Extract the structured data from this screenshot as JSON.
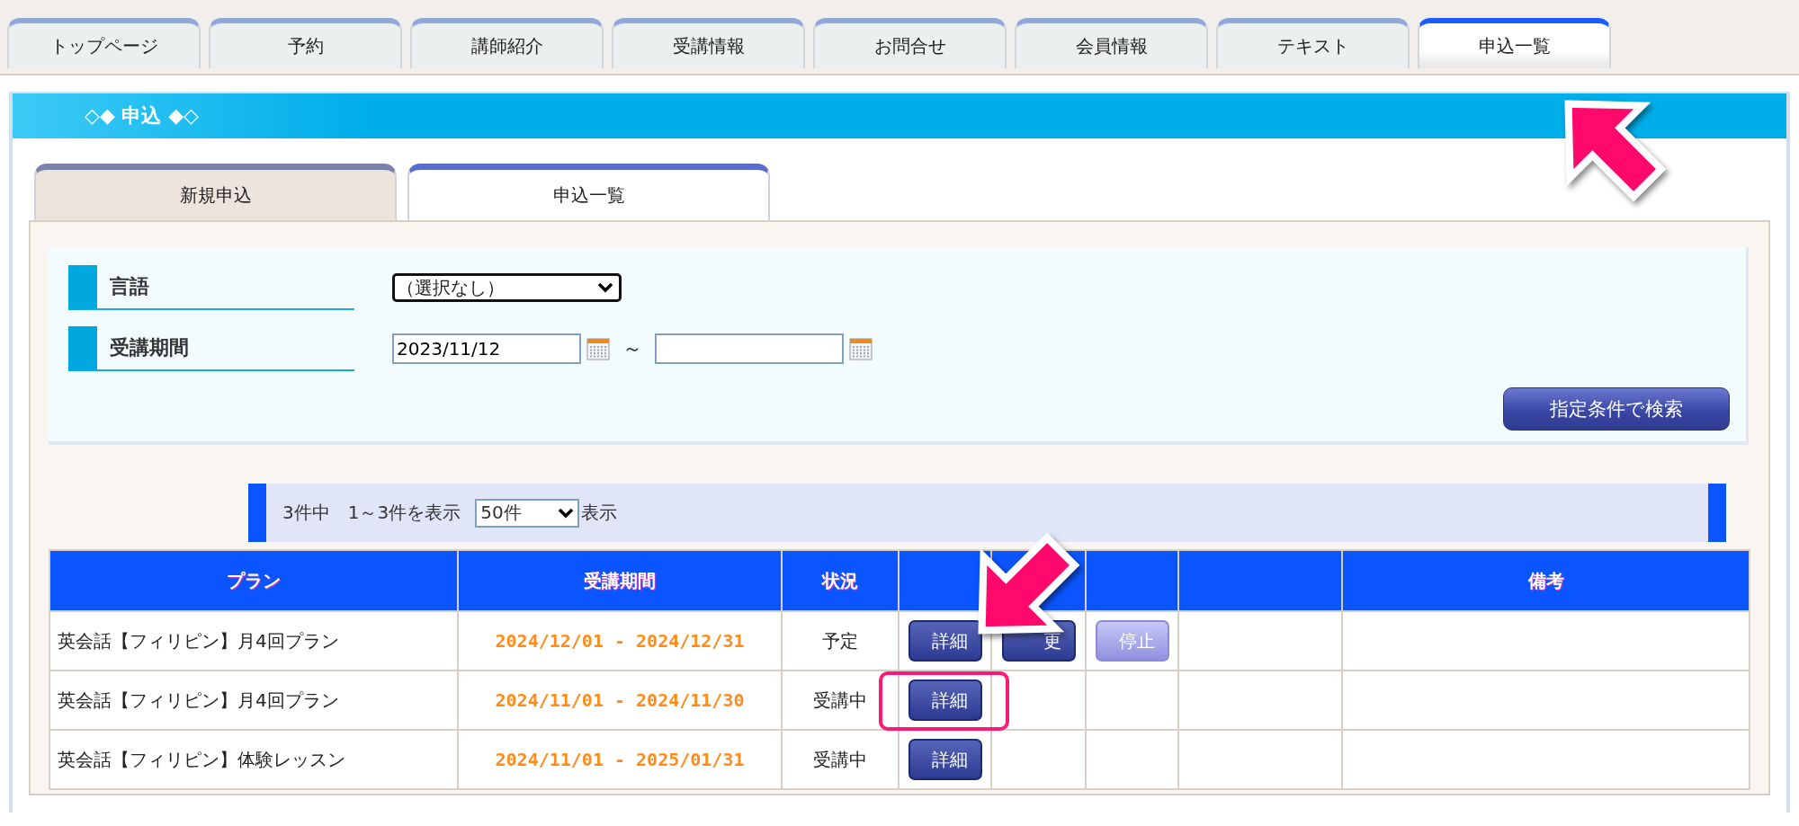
{
  "nav_tabs": [
    {
      "label": "トップページ",
      "selected": false
    },
    {
      "label": "予約",
      "selected": false
    },
    {
      "label": "講師紹介",
      "selected": false
    },
    {
      "label": "受講情報",
      "selected": false
    },
    {
      "label": "お問合せ",
      "selected": false
    },
    {
      "label": "会員情報",
      "selected": false
    },
    {
      "label": "テキスト",
      "selected": false
    },
    {
      "label": "申込一覧",
      "selected": true
    }
  ],
  "section_title": "◇◆ 申込 ◆◇",
  "sub_tabs": [
    {
      "label": "新規申込",
      "selected": false
    },
    {
      "label": "申込一覧",
      "selected": true
    }
  ],
  "search": {
    "fields": [
      {
        "kind": "select",
        "label": "言語",
        "value": "（選択なし）"
      },
      {
        "kind": "date_range",
        "label": "受講期間",
        "from": "2023/11/12",
        "separator": "～"
      }
    ],
    "button": "指定条件で検索"
  },
  "pager": {
    "summary": "3件中　1～3件を表示",
    "per_page": "50件",
    "suffix": "表示"
  },
  "table": {
    "columns": [
      {
        "kind": "text",
        "label": "プラン"
      },
      {
        "kind": "text",
        "label": "受講期間"
      },
      {
        "kind": "text",
        "label": "状況"
      },
      {
        "kind": "action"
      },
      {
        "kind": "action"
      },
      {
        "kind": "action"
      },
      {
        "kind": "blank"
      },
      {
        "kind": "text",
        "label": "備考"
      }
    ],
    "rows": [
      {
        "plan": "英会話【フィリピン】月4回プラン",
        "period": "2024/12/01 - 2024/12/31",
        "status": "予定",
        "actions": [
          {
            "label": "詳細",
            "disabled": false
          },
          {
            "label": "更",
            "disabled": false
          },
          {
            "label": "停止",
            "disabled": true
          }
        ]
      },
      {
        "plan": "英会話【フィリピン】月4回プラン",
        "period": "2024/11/01 - 2024/11/30",
        "status": "受講中",
        "actions": [
          {
            "label": "詳細",
            "disabled": false
          }
        ]
      },
      {
        "plan": "英会話【フィリピン】体験レッスン",
        "period": "2024/11/01 - 2025/01/31",
        "status": "受講中",
        "actions": [
          {
            "label": "詳細",
            "disabled": false
          }
        ]
      }
    ]
  },
  "annotations": [
    {
      "kind": "arrow"
    },
    {
      "kind": "arrow"
    },
    {
      "kind": "frame"
    }
  ]
}
